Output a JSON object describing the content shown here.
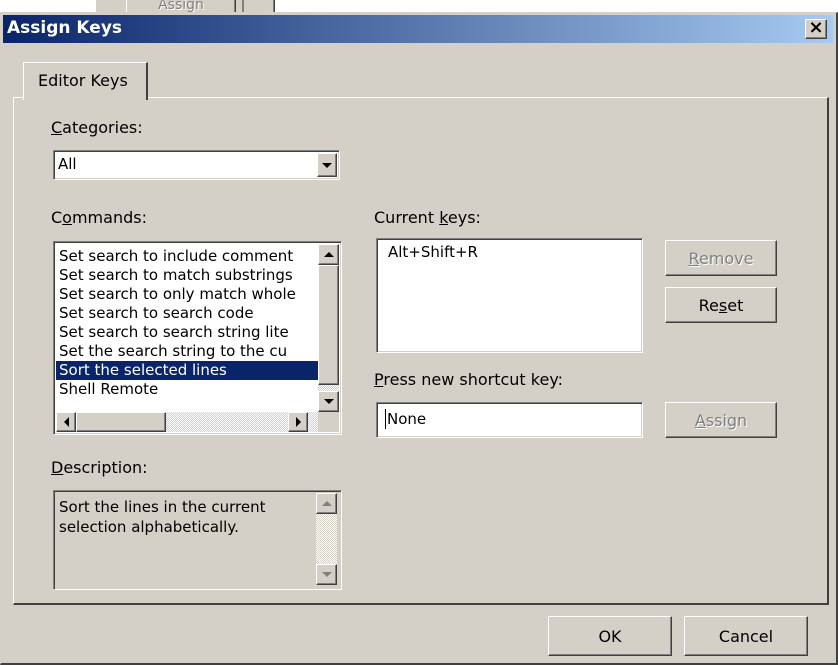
{
  "background_window": {
    "button_label": "Assign"
  },
  "dialog": {
    "title": "Assign Keys",
    "close_glyph": "×",
    "tab": "Editor Keys",
    "categories": {
      "label_underlined": "C",
      "label_rest": "ategories:",
      "selected": "All"
    },
    "commands": {
      "label_pre": "C",
      "label_underlined": "o",
      "label_rest": "mmands:",
      "items": [
        "Set search to include comment",
        "Set search to match substrings",
        "Set search to only match whole",
        "Set search to search code",
        "Set search to search string lite",
        "Set the search string to the cu",
        "Sort the selected lines",
        "Shell Remote"
      ],
      "selected": "Sort the selected lines"
    },
    "current_keys": {
      "label_pre": "Current ",
      "label_underlined": "k",
      "label_rest": "eys:",
      "items": [
        "Alt+Shift+R"
      ]
    },
    "remove_button": {
      "underlined": "R",
      "rest": "emove"
    },
    "reset_button": {
      "pre": "Re",
      "underlined": "s",
      "rest": "et"
    },
    "press_new": {
      "label_underlined": "P",
      "label_rest": "ress new shortcut key:",
      "value": "None"
    },
    "assign_button": {
      "underlined": "A",
      "rest": "ssign"
    },
    "description": {
      "label_underlined": "D",
      "label_rest": "escription:",
      "text": "Sort the lines in the current selection alphabetically."
    },
    "ok_label": "OK",
    "cancel_label": "Cancel"
  },
  "colors": {
    "title_bar_start": "#0a246a",
    "title_bar_end": "#a6caf0",
    "dialog_face": "#d4d0c8",
    "selection": "#0a246a"
  }
}
